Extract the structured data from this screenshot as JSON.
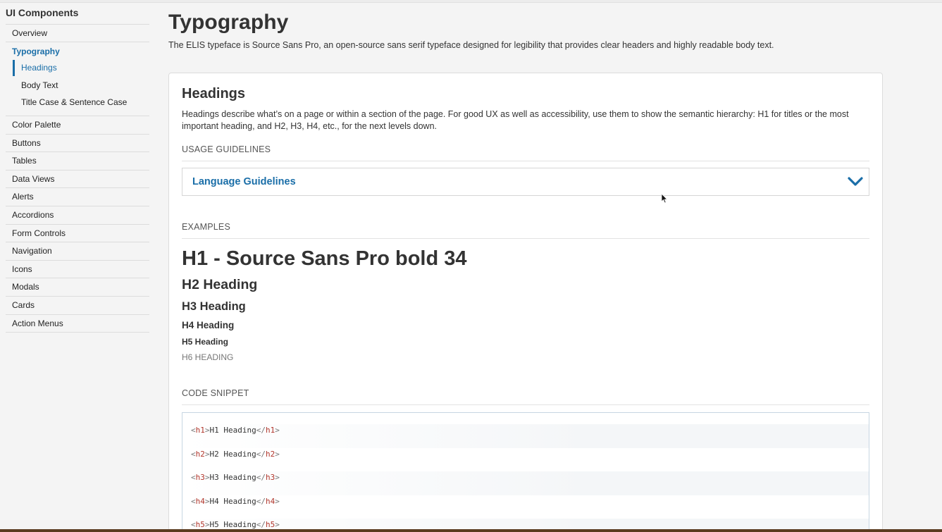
{
  "sidebar": {
    "title": "UI Components",
    "items": [
      {
        "label": "Overview"
      },
      {
        "label": "Typography"
      },
      {
        "label": "Color Palette"
      },
      {
        "label": "Buttons"
      },
      {
        "label": "Tables"
      },
      {
        "label": "Data Views"
      },
      {
        "label": "Alerts"
      },
      {
        "label": "Accordions"
      },
      {
        "label": "Form Controls"
      },
      {
        "label": "Navigation"
      },
      {
        "label": "Icons"
      },
      {
        "label": "Modals"
      },
      {
        "label": "Cards"
      },
      {
        "label": "Action Menus"
      }
    ],
    "subitems": [
      {
        "label": "Headings"
      },
      {
        "label": "Body Text"
      },
      {
        "label": "Title Case & Sentence Case"
      }
    ]
  },
  "page": {
    "title": "Typography",
    "description": "The ELIS typeface is Source Sans Pro, an open-source sans serif typeface designed for legibility that provides clear headers and highly readable body text."
  },
  "card": {
    "title": "Headings",
    "description": "Headings describe what’s on a page or within a section of the page. For good UX as well as accessibility, use them to show the semantic hierarchy: H1 for titles or the most important heading, and H2, H3, H4, etc., for the next levels down.",
    "usage_label": "USAGE GUIDELINES",
    "accordion_title": "Language Guidelines",
    "examples_label": "EXAMPLES",
    "examples": {
      "h1": "H1 - Source Sans Pro bold 34",
      "h2": "H2 Heading",
      "h3": "H3 Heading",
      "h4": "H4 Heading",
      "h5": "H5 Heading",
      "h6": "H6 Heading"
    },
    "code_label": "CODE SNIPPET",
    "code_lines": [
      {
        "tag": "h1",
        "text": "H1 Heading"
      },
      {
        "tag": "h2",
        "text": "H2 Heading"
      },
      {
        "tag": "h3",
        "text": "H3 Heading"
      },
      {
        "tag": "h4",
        "text": "H4 Heading"
      },
      {
        "tag": "h5",
        "text": "H5 Heading"
      }
    ]
  },
  "colors": {
    "accent": "#1a6ea8",
    "code_tag": "#b0352b"
  },
  "icons": {
    "accordion_toggle": "chevron-down-icon",
    "pointer": "mouse-cursor-icon"
  }
}
